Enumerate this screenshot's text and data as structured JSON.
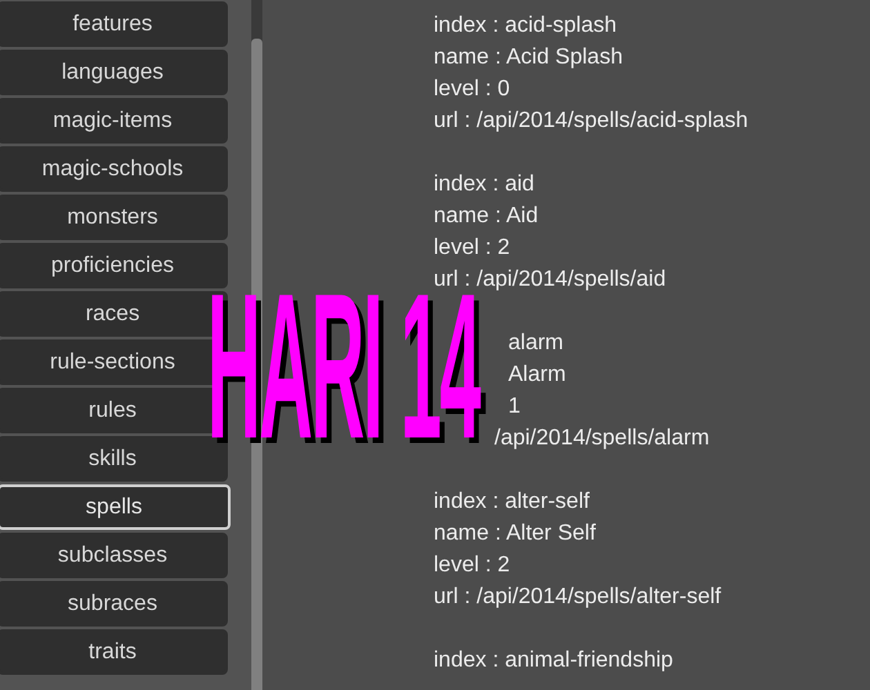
{
  "sidebar": {
    "items": [
      {
        "label": "features",
        "selected": false
      },
      {
        "label": "languages",
        "selected": false
      },
      {
        "label": "magic-items",
        "selected": false
      },
      {
        "label": "magic-schools",
        "selected": false
      },
      {
        "label": "monsters",
        "selected": false
      },
      {
        "label": "proficiencies",
        "selected": false
      },
      {
        "label": "races",
        "selected": false
      },
      {
        "label": "rule-sections",
        "selected": false
      },
      {
        "label": "rules",
        "selected": false
      },
      {
        "label": "skills",
        "selected": false
      },
      {
        "label": "spells",
        "selected": true
      },
      {
        "label": "subclasses",
        "selected": false
      },
      {
        "label": "subraces",
        "selected": false
      },
      {
        "label": "traits",
        "selected": false
      }
    ]
  },
  "results": [
    {
      "lines": [
        {
          "text": "index : acid-splash",
          "kind": "full"
        },
        {
          "text": "name : Acid Splash",
          "kind": "full"
        },
        {
          "text": "level : 0",
          "kind": "full"
        },
        {
          "text": "url : /api/2014/spells/acid-splash",
          "kind": "full"
        }
      ]
    },
    {
      "lines": [
        {
          "text": "index : aid",
          "kind": "full"
        },
        {
          "text": "name : Aid",
          "kind": "full"
        },
        {
          "text": "level : 2",
          "kind": "full"
        },
        {
          "text": "url : /api/2014/spells/aid",
          "kind": "full"
        }
      ]
    },
    {
      "lines": [
        {
          "text": "alarm",
          "kind": "covered"
        },
        {
          "text": "Alarm",
          "kind": "covered"
        },
        {
          "text": "1",
          "kind": "covered"
        },
        {
          "text": "/api/2014/spells/alarm",
          "kind": "covered_url"
        }
      ]
    },
    {
      "lines": [
        {
          "text": "index : alter-self",
          "kind": "full"
        },
        {
          "text": "name : Alter Self",
          "kind": "full"
        },
        {
          "text": "level : 2",
          "kind": "full"
        },
        {
          "text": "url : /api/2014/spells/alter-self",
          "kind": "full"
        }
      ]
    },
    {
      "lines": [
        {
          "text": "index : animal-friendship",
          "kind": "full"
        }
      ]
    }
  ],
  "overlay": {
    "text": "HARI 14"
  }
}
